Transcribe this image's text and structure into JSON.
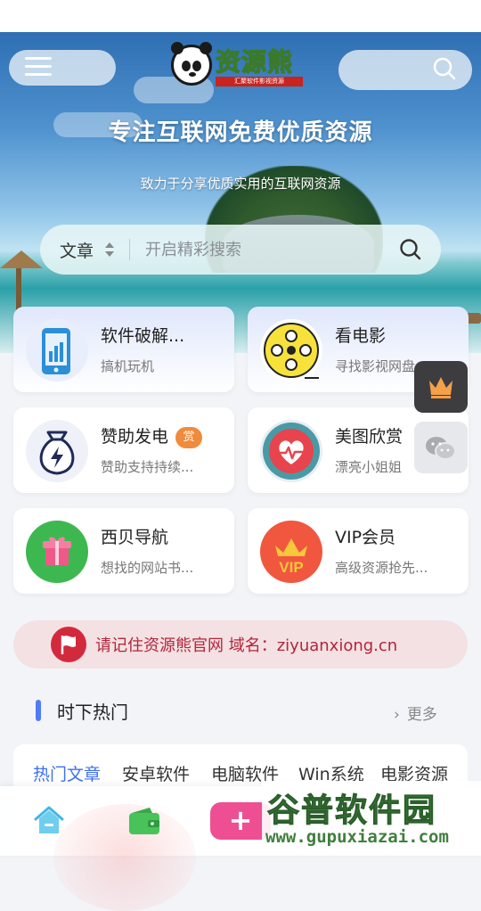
{
  "header": {
    "brand": "资源熊",
    "brand_sub": "汇聚软件影视资源",
    "title": "专注互联网免费优质资源",
    "subtitle": "致力于分享优质实用的互联网资源"
  },
  "search": {
    "category": "文章",
    "placeholder": "开启精彩搜索"
  },
  "cards": [
    {
      "title": "软件破解...",
      "desc": "搞机玩机",
      "icon": "phone-chart-icon"
    },
    {
      "title": "看电影",
      "desc": "寻找影视网盘",
      "icon": "film-reel-icon"
    },
    {
      "title": "赞助发电",
      "badge": "赏",
      "desc": "赞助支持持续...",
      "icon": "money-bag-icon"
    },
    {
      "title": "美图欣赏",
      "desc": "漂亮小姐姐",
      "icon": "heart-pulse-icon"
    },
    {
      "title": "西贝导航",
      "desc": "想找的网站书...",
      "icon": "gift-box-icon"
    },
    {
      "title": "VIP会员",
      "desc": "高级资源抢先...",
      "icon": "vip-crown-icon"
    }
  ],
  "floating": [
    "crown-icon",
    "wechat-icon"
  ],
  "notice": {
    "text": "请记住资源熊官网 域名：ziyuanxiong.cn"
  },
  "section": {
    "title": "时下热门",
    "more": "更多"
  },
  "tabs": [
    "热门文章",
    "安卓软件",
    "电脑软件",
    "Win系统",
    "电影资源"
  ],
  "active_tab": 0,
  "watermark": {
    "text": "谷普软件园",
    "url": "www.gupuxiazai.com"
  },
  "colors": {
    "accent": "#3d6ff2",
    "notice": "#b3243a",
    "add_button": "#ee4f93",
    "badge": "#f08a3c"
  }
}
